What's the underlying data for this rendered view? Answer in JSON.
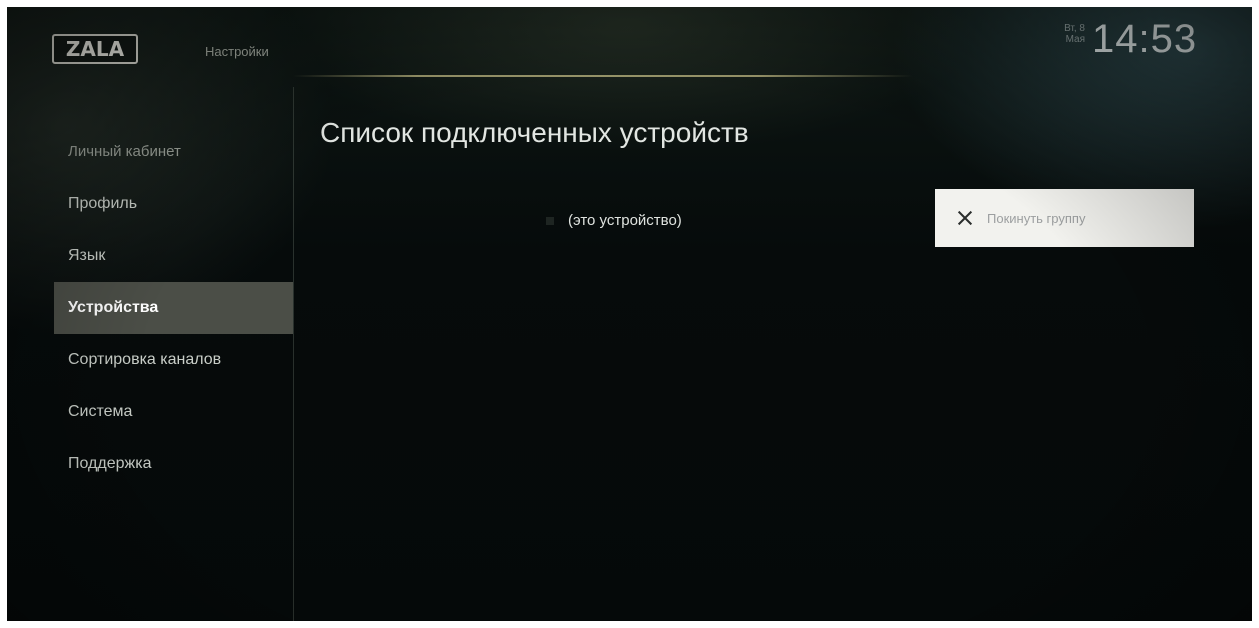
{
  "header": {
    "logo_text": "ZALA",
    "section_title": "Настройки",
    "date_weekday": "Вт, 8",
    "date_month": "Мая",
    "time": "14:53"
  },
  "sidebar": {
    "items": [
      {
        "label": "Личный кабинет"
      },
      {
        "label": "Профиль"
      },
      {
        "label": "Язык"
      },
      {
        "label": "Устройства",
        "active": true
      },
      {
        "label": "Сортировка каналов"
      },
      {
        "label": "Система"
      },
      {
        "label": "Поддержка"
      }
    ]
  },
  "main": {
    "title": "Список подключенных устройств",
    "devices": [
      {
        "label": "(это устройство)"
      }
    ],
    "leave_button": {
      "icon": "close-icon",
      "label": "Покинуть группу"
    }
  },
  "colors": {
    "background": "#060b0b",
    "active_item_bg": "#4b4e47",
    "button_bg": "#f2f2ee",
    "text_primary": "#e2e6e2"
  }
}
